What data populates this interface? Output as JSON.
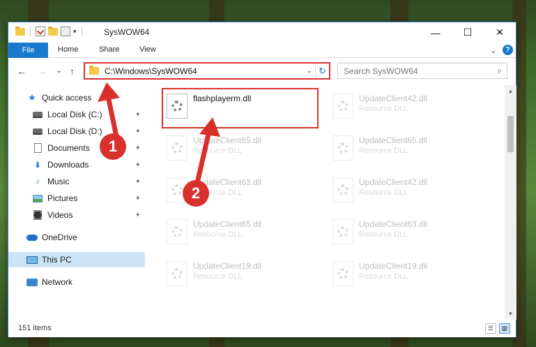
{
  "window": {
    "title": "SysWOW64",
    "minimize": "—",
    "maximize": "☐",
    "close": "✕"
  },
  "ribbon": {
    "file": "File",
    "tabs": [
      "Home",
      "Share",
      "View"
    ],
    "expand": "⌄",
    "help": "?"
  },
  "nav": {
    "back": "←",
    "forward": "→",
    "recent": "⌄",
    "up": "↑",
    "address": "C:\\Windows\\SysWOW64",
    "address_dropdown": "⌄",
    "refresh": "↻",
    "search_placeholder": "Search SysWOW64",
    "search_icon": "⌕"
  },
  "sidebar": {
    "items": [
      {
        "label": "Quick access",
        "icon": "star-icon",
        "pinned": false
      },
      {
        "label": "Local Disk (C:)",
        "icon": "disk-icon",
        "pinned": true
      },
      {
        "label": "Local Disk (D:)",
        "icon": "disk-icon",
        "pinned": true
      },
      {
        "label": "Documents",
        "icon": "document-icon",
        "pinned": true
      },
      {
        "label": "Downloads",
        "icon": "download-icon",
        "pinned": true
      },
      {
        "label": "Music",
        "icon": "music-icon",
        "pinned": true
      },
      {
        "label": "Pictures",
        "icon": "picture-icon",
        "pinned": true
      },
      {
        "label": "Videos",
        "icon": "video-icon",
        "pinned": true
      },
      {
        "label": "OneDrive",
        "icon": "cloud-icon",
        "pinned": false
      },
      {
        "label": "This PC",
        "icon": "computer-icon",
        "pinned": false,
        "selected": true
      },
      {
        "label": "Network",
        "icon": "network-icon",
        "pinned": false
      }
    ],
    "pin_glyph": "📌"
  },
  "files": [
    {
      "name": "flashplayerm.dll",
      "type": "",
      "faded": false
    },
    {
      "name": "UpdateClient42.dll",
      "type": "Resource DLL",
      "faded": true
    },
    {
      "name": "UpdateClient65.dll",
      "type": "Resource DLL",
      "faded": true
    },
    {
      "name": "UpdateClient65.dll",
      "type": "Resource DLL",
      "faded": true
    },
    {
      "name": "UpdateClient63.dll",
      "type": "Resource DLL",
      "faded": true
    },
    {
      "name": "UpdateClient42.dll",
      "type": "Resource DLL",
      "faded": true
    },
    {
      "name": "UpdateClient65.dll",
      "type": "Resource DLL",
      "faded": true
    },
    {
      "name": "UpdateClient63.dll",
      "type": "Resource DLL",
      "faded": true
    },
    {
      "name": "UpdateClient19.dll",
      "type": "Resource DLL",
      "faded": true
    },
    {
      "name": "UpdateClient19.dll",
      "type": "Resource DLL",
      "faded": true
    }
  ],
  "status": {
    "item_count": "151 items"
  },
  "callouts": [
    "1",
    "2"
  ],
  "colors": {
    "accent": "#1979ca",
    "highlight_red": "#d9302c",
    "selection": "#cce4f7"
  }
}
